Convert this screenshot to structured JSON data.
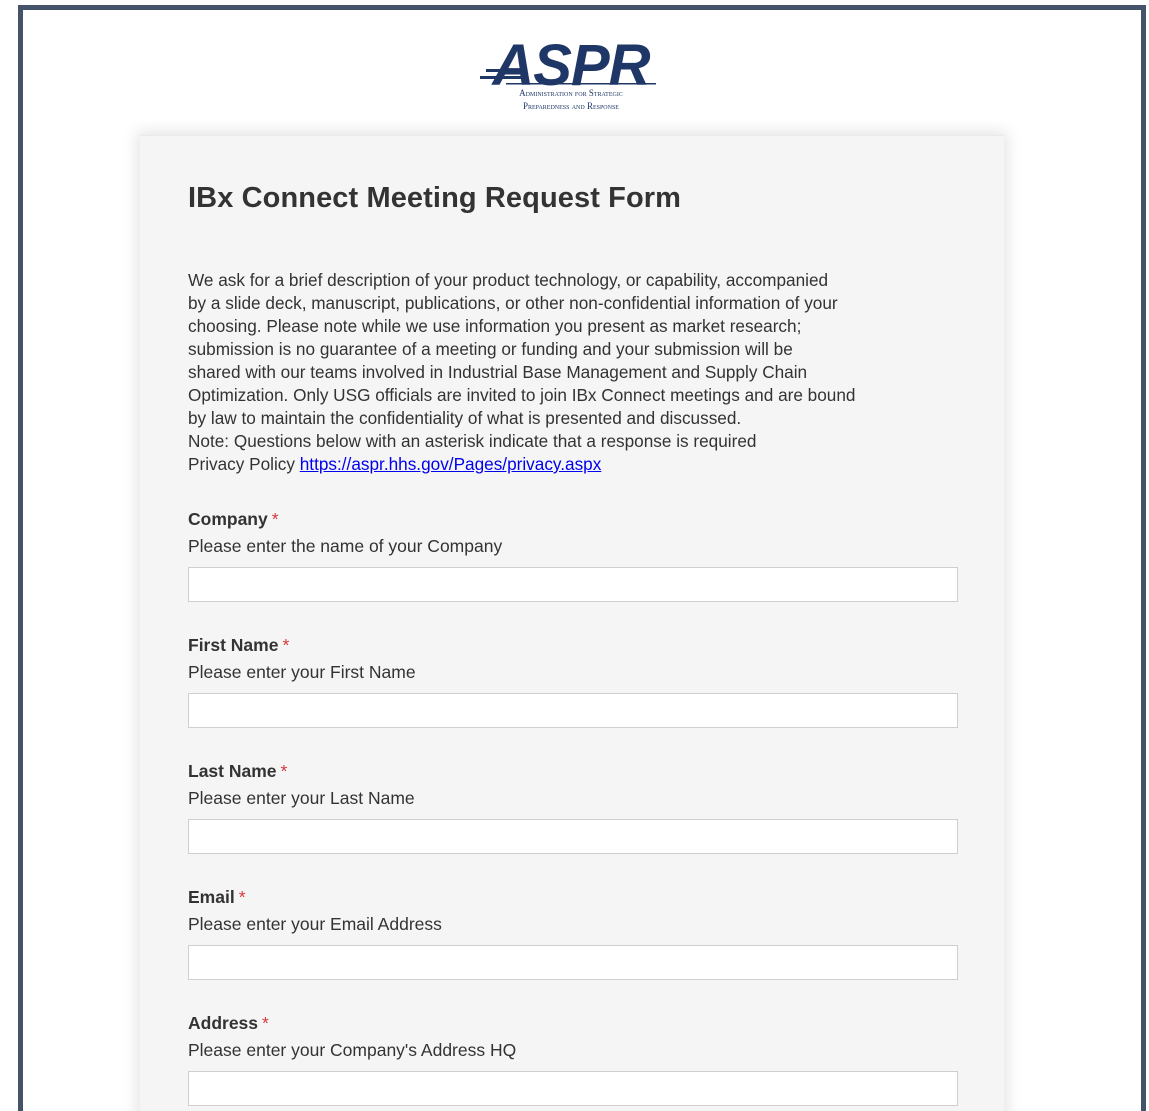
{
  "logo": {
    "text": "ASPR",
    "line1": "Administration for Strategic",
    "line2": "Preparedness and Response",
    "color": "#1f3766"
  },
  "form": {
    "title": "IBx Connect Meeting Request Form",
    "description_lines": [
      "We ask for a brief description of your product technology, or capability, accompanied",
      "by a slide deck, manuscript, publications, or other non-confidential information of your",
      "choosing. Please note while we use information you present as market research;",
      "submission is no guarantee of a meeting or funding and your submission will be",
      "shared with our teams involved in Industrial Base Management and Supply Chain",
      "Optimization. Only USG officials are invited to join IBx Connect meetings and are bound",
      "by law to maintain the confidentiality of what is presented and discussed.",
      "Note: Questions below with an asterisk indicate that a response is required"
    ],
    "privacy_label": "Privacy Policy",
    "privacy_link": "https://aspr.hhs.gov/Pages/privacy.aspx",
    "required_marker": "*",
    "fields": [
      {
        "label": "Company",
        "description": "Please enter the name of your Company",
        "value": ""
      },
      {
        "label": "First Name",
        "description": "Please enter your First Name",
        "value": ""
      },
      {
        "label": "Last Name",
        "description": "Please enter your Last Name",
        "value": ""
      },
      {
        "label": "Email",
        "description": "Please enter your Email Address",
        "value": ""
      },
      {
        "label": "Address",
        "description": "Please enter your Company's Address HQ",
        "value": ""
      }
    ]
  },
  "colors": {
    "frame_border": "#44536a",
    "card_background": "#f5f5f5",
    "required_asterisk": "#d63939",
    "link": "#0000ee"
  }
}
